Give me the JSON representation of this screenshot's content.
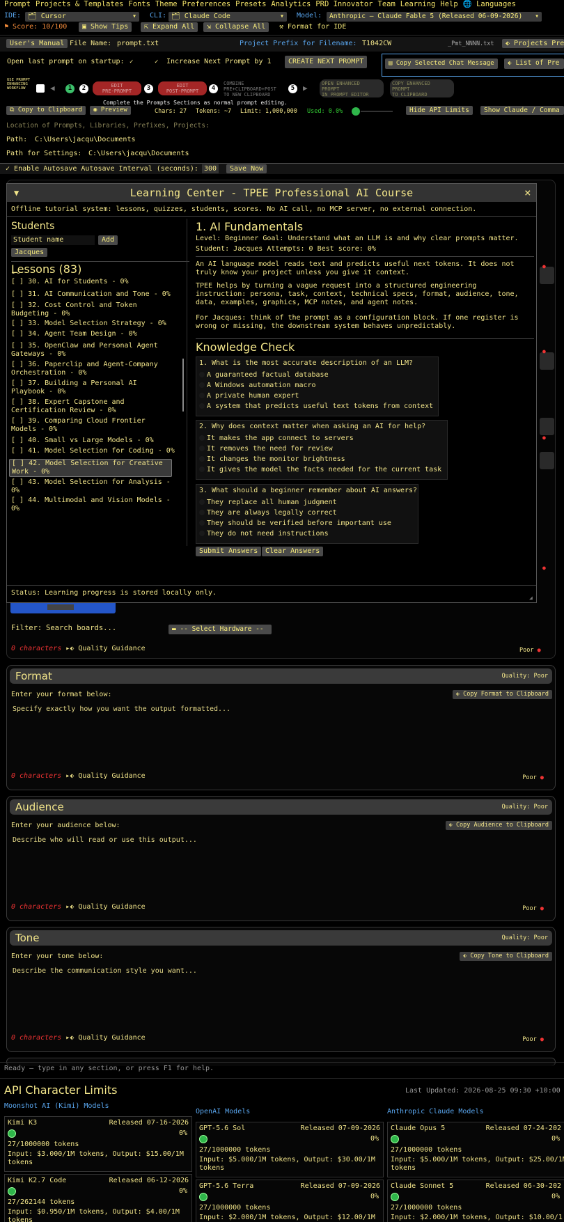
{
  "menu": [
    "Prompt",
    "Projects & Templates",
    "Fonts",
    "Theme",
    "Preferences",
    "Presets",
    "Analytics",
    "PRD Innovator",
    "Team",
    "Learning",
    "Help",
    "🌐 Languages"
  ],
  "toolbar": {
    "ide_label": "IDE:",
    "ide_value": "Cursor",
    "cli_label": "CLI:",
    "cli_value": "Claude Code",
    "model_label": "Model:",
    "model_value": "Anthropic — Claude Fable 5 (Released 06-09-2026)",
    "score": "Score: 10/100",
    "show_tips": "Show Tips",
    "expand_all": "Expand All",
    "collapse_all": "Collapse All",
    "format_ide": "Format for IDE"
  },
  "file": {
    "manual": "User's Manual",
    "file_label": "File Name:",
    "file_value": "prompt.txt",
    "prefix_label": "Project Prefix for Filename:",
    "prefix_value": "T1042CW",
    "pattern": "_Pmt_NNNN.txt",
    "projects": "Projects Pre"
  },
  "options": {
    "open_last": "Open last prompt on startup:",
    "increase": "Increase Next Prompt by 1",
    "create_next": "CREATE NEXT PROMPT",
    "copy_selected": "Copy Selected Chat Message",
    "list_of": "List of Pre"
  },
  "workflow": {
    "label": "USE PROMPT\nENHANCING\nWORKFLOW",
    "s1": "1",
    "s2": "2",
    "s3": "3",
    "s4": "4",
    "s5": "5",
    "edit_pre": "EDIT\nPRE-PROMPT",
    "edit_post": "EDIT\nPOST-PROMPT",
    "combine": "COMBINE\nPRE+CLIPBOARD+POST\nTO NEW CLIPBOARD",
    "open_enh": "OPEN ENHANCED\nPROMPT\nIN PROMPT EDITOR",
    "copy_enh": "COPY ENHANCED\nPROMPT\nTO CLIPBOARD",
    "hint": "Complete the Prompts Sections as normal prompt editing."
  },
  "stats": {
    "copy": "Copy to Clipboard",
    "preview": "Preview",
    "chars": "Chars: 27",
    "tokens": "Tokens: ~7",
    "limit": "Limit: 1,000,000",
    "used": "Used: 0.0%",
    "hide_api": "Hide API Limits",
    "show_claude": "Show Claude / Comma"
  },
  "paths": {
    "loc_label": "Location of Prompts, Libraries, Prefixes, Projects:",
    "path_label": "Path:",
    "path_value": "C:\\Users\\jacqu\\Documents",
    "settings_label": "Path for Settings:",
    "settings_value": "C:\\Users\\jacqu\\Documents"
  },
  "autosave": {
    "label": "Enable Autosave Autosave Interval (seconds):",
    "value": "300",
    "save": "Save Now"
  },
  "modal": {
    "title": "Learning Center - TPEE Professional AI Course",
    "close": "×",
    "subtitle": "Offline tutorial system: lessons, quizzes, students, scores. No AI call, no MCP server, no external connection.",
    "students_title": "Students",
    "student_placeholder": "Student name",
    "add": "Add",
    "student": "Jacques",
    "lessons_title": "Lessons (83)",
    "lessons": [
      "0%",
      "[ ] 30. AI for Students - 0%",
      "[ ] 31. AI Communication and Tone - 0%",
      "[ ] 32. Cost Control and Token\nBudgeting - 0%",
      "[ ] 33. Model Selection Strategy - 0%",
      "[ ] 34. Agent Team Design - 0%",
      "[ ] 35. OpenClaw and Personal Agent\nGateways - 0%",
      "[ ] 36. Paperclip and Agent-Company\nOrchestration - 0%",
      "[ ] 37. Building a Personal AI\nPlaybook - 0%",
      "[ ] 38. Expert Capstone and\nCertification Review - 0%",
      "[ ] 39. Comparing Cloud Frontier\nModels - 0%",
      "[ ] 40. Small vs Large Models - 0%",
      "[ ] 41. Model Selection for Coding - 0%",
      "[ ] 42. Model Selection for Creative\nWork - 0%",
      "[ ] 43. Model Selection for Analysis -\n0%",
      "[ ] 44. Multimodal and Vision Models -\n0%"
    ],
    "lesson_title": "1. AI Fundamentals",
    "meta1": "Level: Beginner   Goal: Understand what an LLM is and why clear prompts matter.",
    "meta2": "Student: Jacques   Attempts: 0   Best score: 0%",
    "p1": "An AI language model reads text and predicts useful next tokens. It does not truly know your project unless you give it context.",
    "p2": "TPEE helps by turning a vague request into a structured engineering instruction: persona, task, context, technical specs, format, audience, tone, data, examples, graphics, MCP notes, and agent notes.",
    "p3": "For Jacques: think of the prompt as a configuration block. If one register is wrong or missing, the downstream system behaves unpredictably.",
    "kc": "Knowledge Check",
    "q1": "1. What is the most accurate description of an LLM?",
    "q1o": [
      "A guaranteed factual database",
      "A Windows automation macro",
      "A private human expert",
      "A system that predicts useful text tokens from context"
    ],
    "q2": "2. Why does context matter when asking an AI for help?",
    "q2o": [
      "It makes the app connect to servers",
      "It removes the need for review",
      "It changes the monitor brightness",
      "It gives the model the facts needed for the current task"
    ],
    "q3": "3. What should a beginner remember about AI answers?",
    "q3o": [
      "They replace all human judgment",
      "They are always legally correct",
      "They should be verified before important use",
      "They do not need instructions"
    ],
    "submit": "Submit Answers",
    "clear": "Clear Answers",
    "status": "Status: Learning progress is stored locally only."
  },
  "filter": {
    "label": "Filter:",
    "placeholder": "Search boards...",
    "hardware": "-- Select Hardware --"
  },
  "sec0": {
    "chars": "0 characters",
    "qg": "Quality Guidance",
    "poor": "Poor"
  },
  "sections": [
    {
      "title": "Format",
      "quality": "Quality: Poor",
      "prompt": "Enter your format below:",
      "copy": "Copy Format to Clipboard",
      "ph": "Specify exactly how you want the output formatted...",
      "chars": "0 characters",
      "qg": "Quality Guidance",
      "poor": "Poor"
    },
    {
      "title": "Audience",
      "quality": "Quality: Poor",
      "prompt": "Enter your audience below:",
      "copy": "Copy Audience to Clipboard",
      "ph": "Describe who will read or use this output...",
      "chars": "0 characters",
      "qg": "Quality Guidance",
      "poor": "Poor"
    },
    {
      "title": "Tone",
      "quality": "Quality: Poor",
      "prompt": "Enter your tone below:",
      "copy": "Copy Tone to Clipboard",
      "ph": "Describe the communication style you want...",
      "chars": "0 characters",
      "qg": "Quality Guidance",
      "poor": "Poor"
    }
  ],
  "statusbar": "Ready — type in any section, or press F1 for help.",
  "api": {
    "title": "API Character Limits",
    "updated": "Last Updated: 2026-08-25 09:30 +10:00",
    "col1": "Moonshot AI (Kimi) Models",
    "col2": "OpenAI Models",
    "col3": "Anthropic Claude Models",
    "cards": [
      {
        "name": "Kimi K3",
        "rel": "Released 07-16-2026",
        "pct": "0%",
        "tok": "27/1000000 tokens",
        "price": "Input: $3.000/1M tokens, Output: $15.00/1M tokens"
      },
      {
        "name": "GPT-5.6 Sol",
        "rel": "Released 07-09-2026",
        "pct": "0%",
        "tok": "27/1000000 tokens",
        "price": "Input: $5.000/1M tokens, Output: $30.00/1M tokens"
      },
      {
        "name": "Claude Opus 5",
        "rel": "Released 07-24-202",
        "pct": "0%",
        "tok": "27/1000000 tokens",
        "price": "Input: $5.000/1M tokens, Output: $25.00/1M tokens"
      },
      {
        "name": "Kimi K2.7 Code",
        "rel": "Released 06-12-2026",
        "pct": "0%",
        "tok": "27/262144 tokens",
        "price": "Input: $0.950/1M tokens, Output: $4.00/1M tokens"
      },
      {
        "name": "GPT-5.6 Terra",
        "rel": "Released 07-09-2026",
        "pct": "0%",
        "tok": "27/1000000 tokens",
        "price": "Input: $2.000/1M tokens, Output: $12.00/1M"
      },
      {
        "name": "Claude Sonnet 5",
        "rel": "Released 06-30-202",
        "pct": "0%",
        "tok": "27/1000000 tokens",
        "price": "Input: $2.000/1M tokens, Output: $10.00/1"
      }
    ]
  }
}
